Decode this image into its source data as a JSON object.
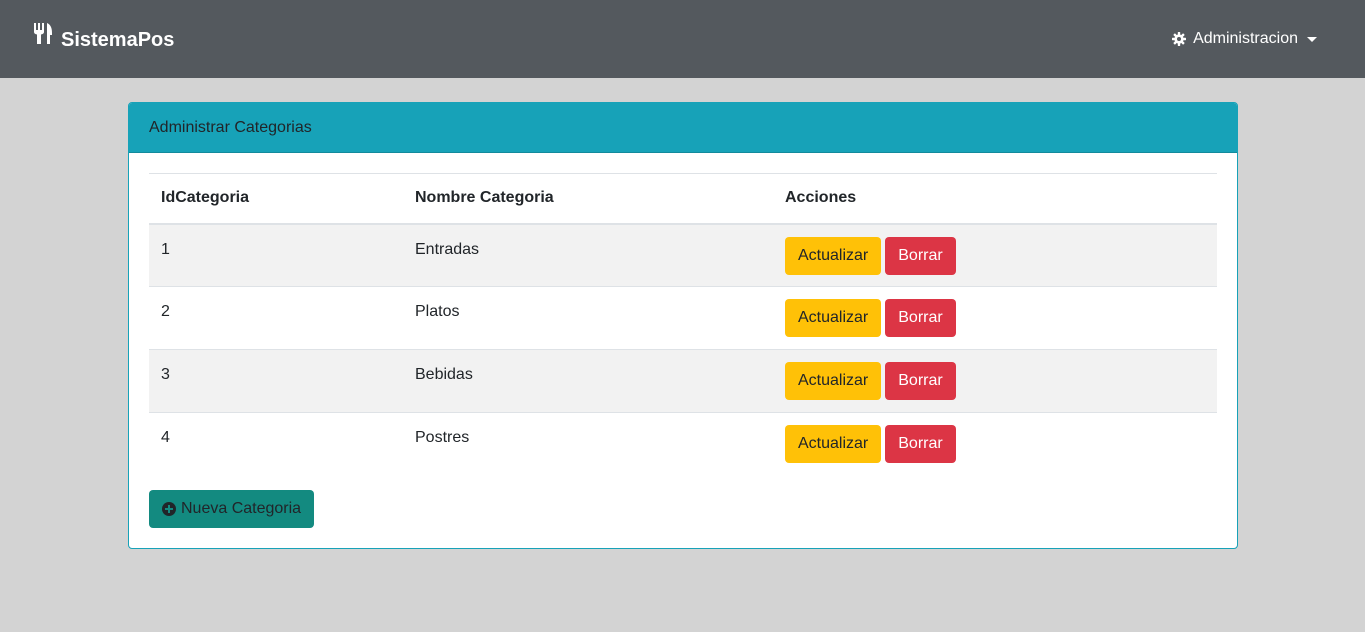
{
  "navbar": {
    "brand_icon": "utensils-icon",
    "brand": "SistemaPos",
    "menu_icon": "gear-icon",
    "menu_label": "Administracion"
  },
  "card": {
    "title": "Administrar Categorias",
    "columns": [
      "IdCategoria",
      "Nombre Categoria",
      "Acciones"
    ],
    "rows": [
      {
        "id": "1",
        "name": "Entradas",
        "update_label": "Actualizar",
        "delete_label": "Borrar"
      },
      {
        "id": "2",
        "name": "Platos",
        "update_label": "Actualizar",
        "delete_label": "Borrar"
      },
      {
        "id": "3",
        "name": "Bebidas",
        "update_label": "Actualizar",
        "delete_label": "Borrar"
      },
      {
        "id": "4",
        "name": "Postres",
        "update_label": "Actualizar",
        "delete_label": "Borrar"
      }
    ],
    "new_button_icon": "plus-circle-icon",
    "new_button": "Nueva Categoria"
  },
  "colors": {
    "navbar": "#54595e",
    "background": "#d3d3d3",
    "header": "#17a2b8",
    "warning": "#ffc107",
    "danger": "#dc3545",
    "new_button": "#138a80"
  }
}
